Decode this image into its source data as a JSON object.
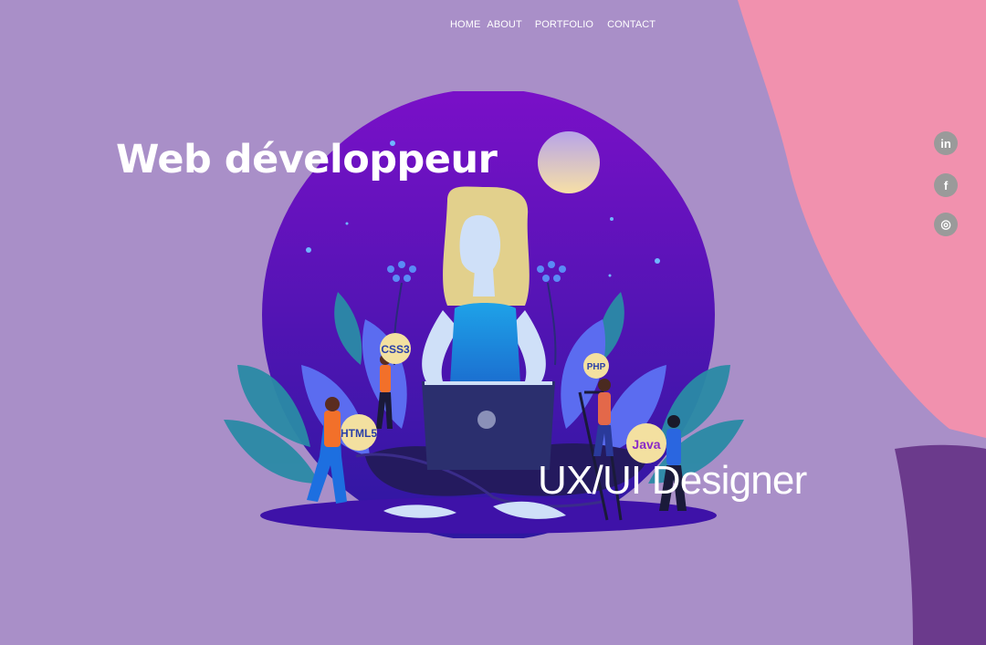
{
  "nav": {
    "items": [
      {
        "label": "HOME"
      },
      {
        "label": "ABOUT"
      },
      {
        "label": "PORTFOLIO"
      },
      {
        "label": "CONTACT"
      }
    ]
  },
  "hero": {
    "title_primary": "Web développeur",
    "title_secondary": "UX/UI Designer"
  },
  "skills": {
    "css": "CSS3",
    "html": "HTML5",
    "php": "PHP",
    "java": "Java"
  },
  "social": {
    "linkedin": "in",
    "facebook": "f",
    "instagram": "◎"
  },
  "colors": {
    "background": "#a98fc8",
    "pink_wave": "#f191ae",
    "dark_wave": "#6b3a8c",
    "circle_top": "#7a10c8",
    "circle_bottom": "#3a16a8"
  }
}
